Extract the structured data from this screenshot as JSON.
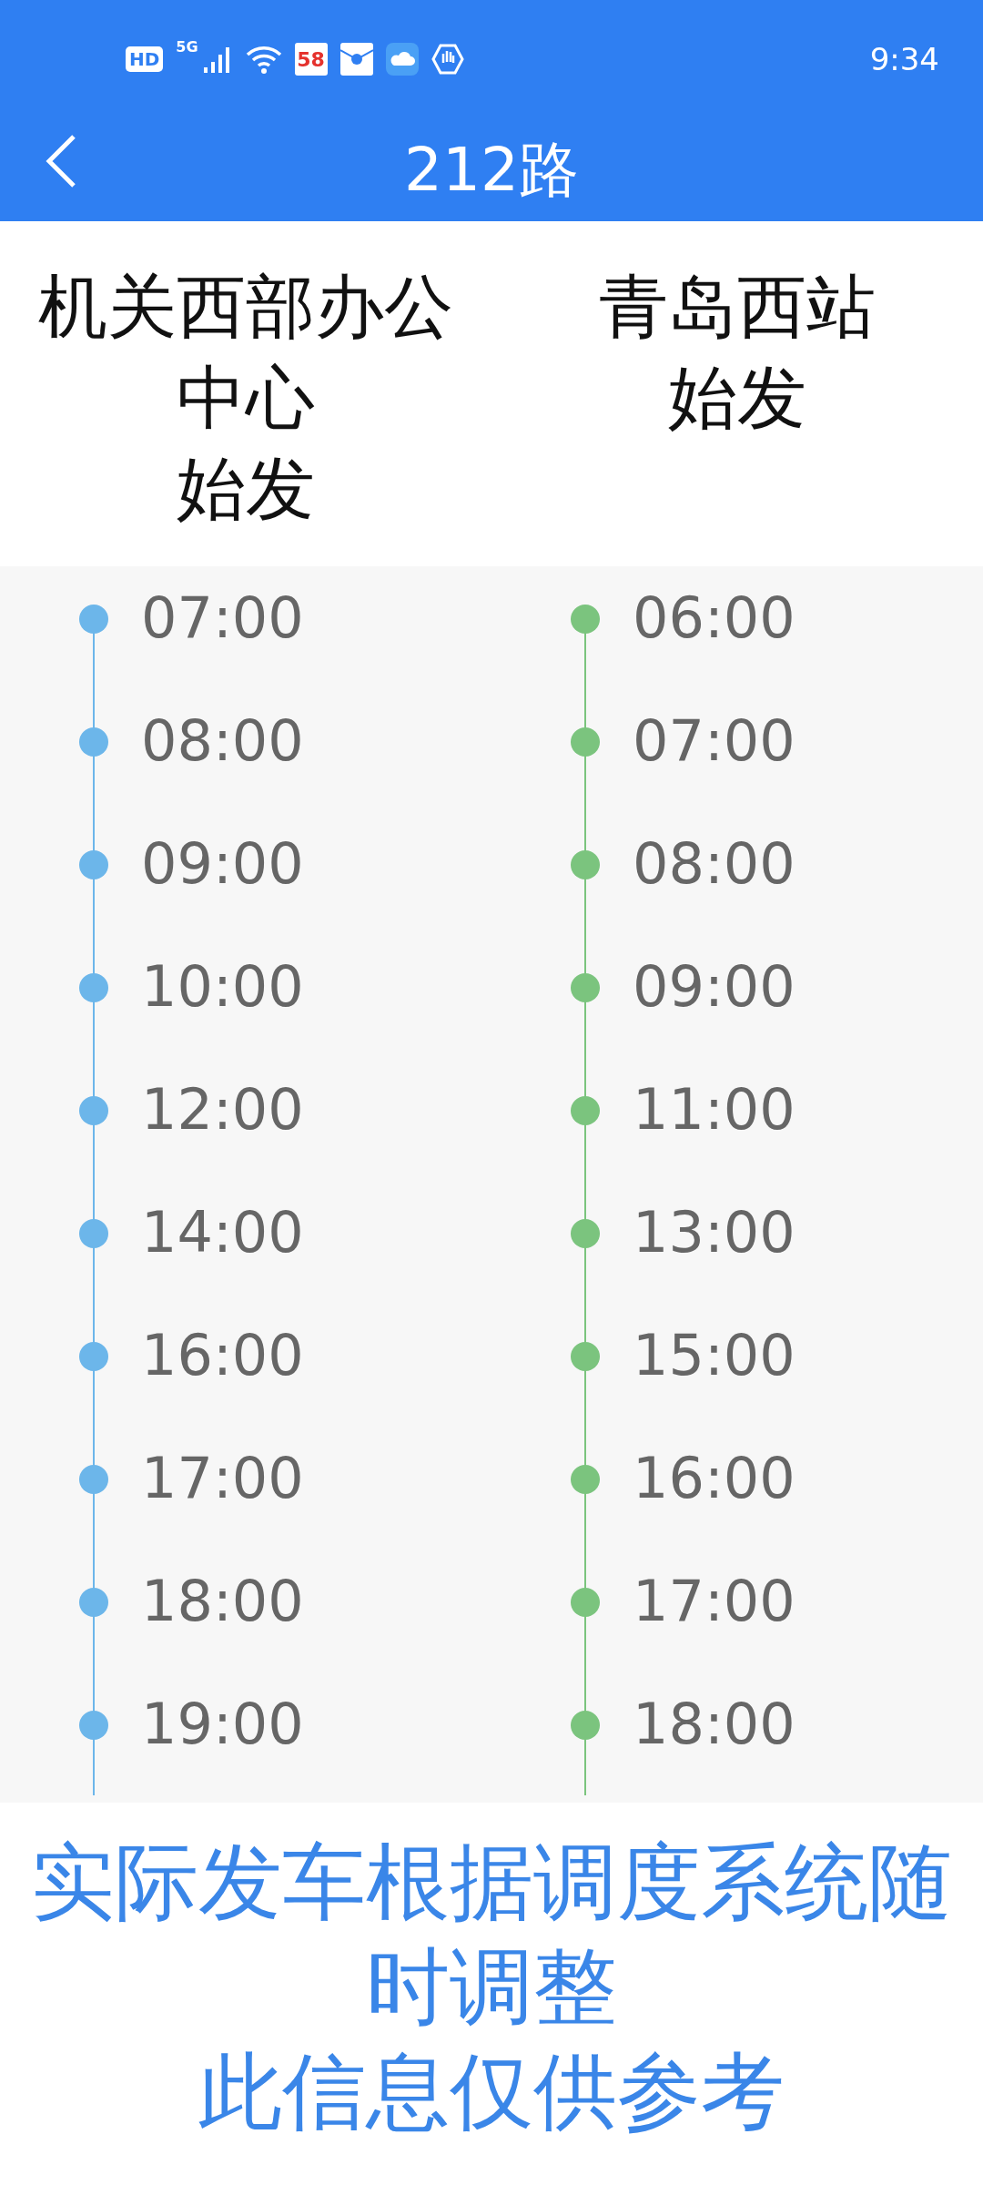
{
  "status_bar": {
    "hd": "HD",
    "network": "5G",
    "app_badge": "58",
    "time": "9:34"
  },
  "header": {
    "title": "212路"
  },
  "columns": [
    {
      "origin": "机关西部办公中心",
      "suffix": "始发",
      "color": "#6cb6ea",
      "times": [
        "07:00",
        "08:00",
        "09:00",
        "10:00",
        "12:00",
        "14:00",
        "16:00",
        "17:00",
        "18:00",
        "19:00"
      ]
    },
    {
      "origin": "青岛西站",
      "suffix": "始发",
      "color": "#7bc47e",
      "times": [
        "06:00",
        "07:00",
        "08:00",
        "09:00",
        "11:00",
        "13:00",
        "15:00",
        "16:00",
        "17:00",
        "18:00"
      ]
    }
  ],
  "notes": [
    "实际发车根据调度系统随时调整",
    "此信息仅供参考"
  ]
}
